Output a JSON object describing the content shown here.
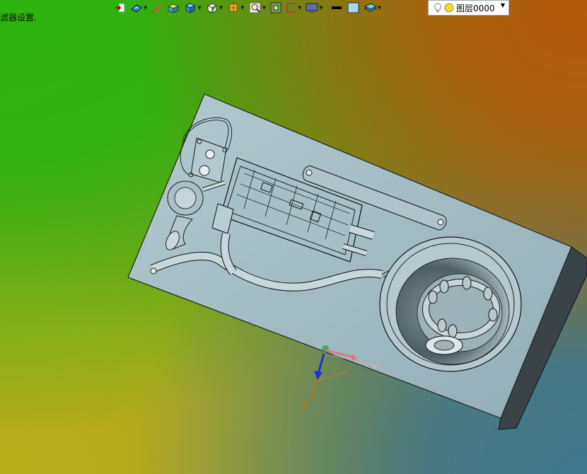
{
  "status_bar": {
    "message": "滤器设置."
  },
  "toolbar": {
    "buttons": [
      {
        "icon": "exit-icon",
        "has_dropdown": false
      },
      {
        "icon": "view-orient-icon",
        "has_dropdown": true
      },
      {
        "icon": "pen-icon",
        "has_dropdown": false
      },
      {
        "icon": "solid-box-icon",
        "has_dropdown": false
      },
      {
        "icon": "shaded-cube-icon",
        "has_dropdown": true
      },
      {
        "icon": "wireframe-cube-icon",
        "has_dropdown": true
      },
      {
        "icon": "section-icon",
        "has_dropdown": true
      },
      {
        "icon": "zoom-icon",
        "has_dropdown": true
      },
      {
        "icon": "grid-icon",
        "has_dropdown": false
      },
      {
        "icon": "frame-icon",
        "has_dropdown": true
      },
      {
        "icon": "display-icon",
        "has_dropdown": true
      },
      {
        "icon": "line-color-icon",
        "has_dropdown": false
      },
      {
        "icon": "fill-color-icon",
        "has_dropdown": false
      },
      {
        "icon": "layers-icon",
        "has_dropdown": true
      }
    ],
    "layer_selector": {
      "label": "图层0000",
      "bulb_icon": "lightbulb-icon",
      "color_icon": "layer-color-icon"
    }
  },
  "viewport": {
    "triad": {
      "axis_label_z": "Z"
    },
    "colors": {
      "part": "#9fb7bf",
      "edge": "#1a1a1a",
      "x_axis": "#e06060",
      "z_axis": "#2030d0",
      "z_label": "#d07000"
    }
  }
}
